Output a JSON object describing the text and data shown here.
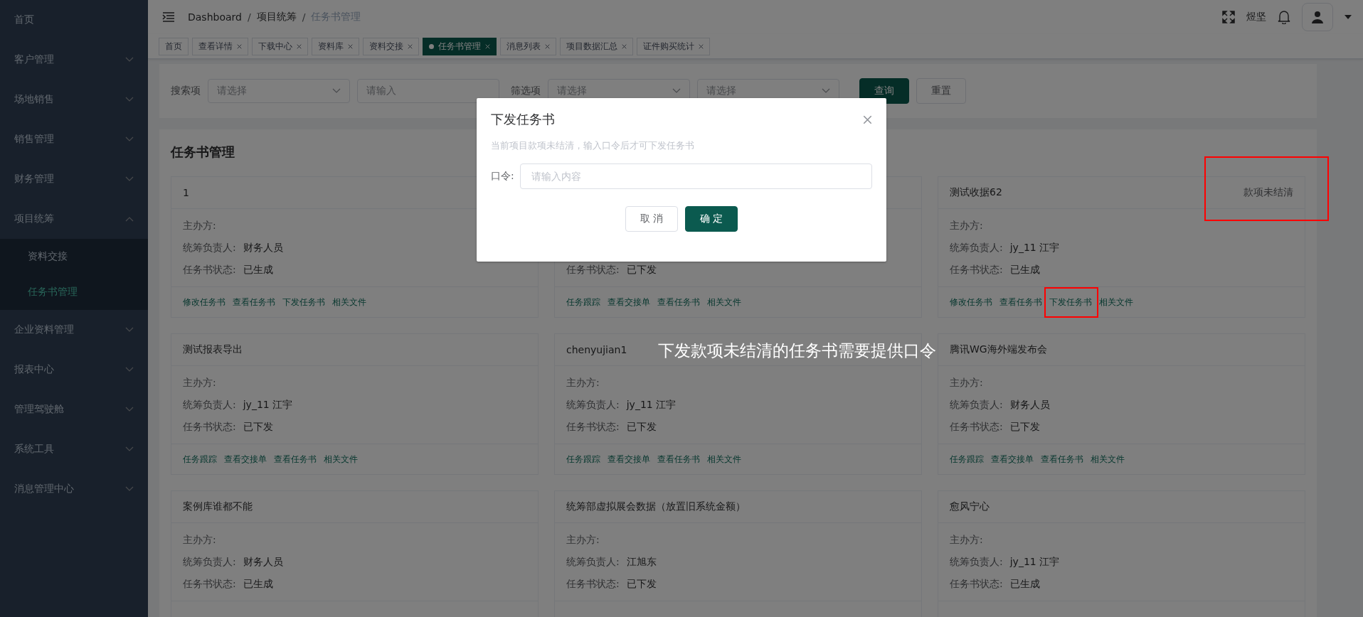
{
  "sidebar": {
    "items": [
      {
        "kind": "link",
        "label": "首页"
      },
      {
        "kind": "menu",
        "label": "客户管理",
        "expanded": false
      },
      {
        "kind": "menu",
        "label": "场地销售",
        "expanded": false
      },
      {
        "kind": "menu",
        "label": "销售管理",
        "expanded": false
      },
      {
        "kind": "menu",
        "label": "财务管理",
        "expanded": false
      },
      {
        "kind": "menu",
        "label": "项目统筹",
        "expanded": true,
        "children": [
          {
            "label": "资料交接",
            "selected": false
          },
          {
            "label": "任务书管理",
            "selected": true
          }
        ]
      },
      {
        "kind": "menu",
        "label": "企业资料管理",
        "expanded": false
      },
      {
        "kind": "menu",
        "label": "报表中心",
        "expanded": false
      },
      {
        "kind": "menu",
        "label": "管理驾驶舱",
        "expanded": false
      },
      {
        "kind": "menu",
        "label": "系统工具",
        "expanded": false
      },
      {
        "kind": "menu",
        "label": "消息管理中心",
        "expanded": false
      }
    ]
  },
  "navbar": {
    "breadcrumb": {
      "separator": "/",
      "items": [
        {
          "label": "Dashboard",
          "current": false
        },
        {
          "label": "项目统筹",
          "current": false
        },
        {
          "label": "任务书管理",
          "current": true
        }
      ]
    },
    "username": "煜坚"
  },
  "tabs": [
    {
      "label": "首页",
      "selected": false,
      "closable": false
    },
    {
      "label": "查看详情",
      "selected": false,
      "closable": true
    },
    {
      "label": "下载中心",
      "selected": false,
      "closable": true
    },
    {
      "label": "资料库",
      "selected": false,
      "closable": true
    },
    {
      "label": "资料交接",
      "selected": false,
      "closable": true
    },
    {
      "label": "任务书管理",
      "selected": true,
      "closable": true
    },
    {
      "label": "消息列表",
      "selected": false,
      "closable": true
    },
    {
      "label": "项目数据汇总",
      "selected": false,
      "closable": true
    },
    {
      "label": "证件购买统计",
      "selected": false,
      "closable": true
    }
  ],
  "search": {
    "fields": [
      {
        "kind": "label",
        "text": "搜索项"
      },
      {
        "kind": "select",
        "placeholder": "请选择"
      },
      {
        "kind": "input",
        "placeholder": "请输入"
      },
      {
        "kind": "label",
        "text": "筛选项"
      },
      {
        "kind": "select",
        "placeholder": "请选择"
      },
      {
        "kind": "select",
        "placeholder": "请选择"
      }
    ],
    "buttons": [
      {
        "label": "查询",
        "kind": "primary"
      },
      {
        "label": "重置",
        "kind": "default"
      }
    ]
  },
  "panel": {
    "title": "任务书管理",
    "rows": [
      {
        "cards": [
          {
            "title": "1",
            "fields": [
              {
                "kind": "organizer",
                "label": "主办方:"
              },
              {
                "kind": "manager",
                "label": "统筹负责人:",
                "value": "财务人员"
              },
              {
                "kind": "status",
                "label": "任务书状态:",
                "value": "已生成"
              }
            ],
            "links": [
              "修改任务书",
              "查看任务书",
              "下发任务书",
              "相关文件"
            ]
          },
          {
            "fields": [
              {
                "kind": "status",
                "label": "任务书状态:",
                "value": "已下发"
              }
            ],
            "links": [
              "任务跟踪",
              "查看交接单",
              "查看任务书",
              "相关文件"
            ]
          },
          {
            "title": "测试收据62",
            "badge": "款项未结清",
            "fields": [
              {
                "kind": "organizer",
                "label": "主办方:"
              },
              {
                "kind": "manager",
                "label": "统筹负责人:",
                "value": "jy_11 江宇"
              },
              {
                "kind": "status",
                "label": "任务书状态:",
                "value": "已生成"
              }
            ],
            "links": [
              "修改任务书",
              "查看任务书",
              "下发任务书",
              "相关文件"
            ]
          }
        ]
      },
      {
        "cards": [
          {
            "title": "测试报表导出",
            "fields": [
              {
                "kind": "organizer",
                "label": "主办方:"
              },
              {
                "kind": "manager",
                "label": "统筹负责人:",
                "value": "jy_11 江宇"
              },
              {
                "kind": "status",
                "label": "任务书状态:",
                "value": "已下发"
              }
            ],
            "links": [
              "任务跟踪",
              "查看交接单",
              "查看任务书",
              "相关文件"
            ]
          },
          {
            "title": "chenyujian1",
            "fields": [
              {
                "kind": "organizer",
                "label": "主办方:"
              },
              {
                "kind": "manager",
                "label": "统筹负责人:",
                "value": "jy_11 江宇"
              },
              {
                "kind": "status",
                "label": "任务书状态:",
                "value": "已下发"
              }
            ],
            "links": [
              "任务跟踪",
              "查看交接单",
              "查看任务书",
              "相关文件"
            ]
          },
          {
            "title": "腾讯WG海外端发布会",
            "fields": [
              {
                "kind": "organizer",
                "label": "主办方:"
              },
              {
                "kind": "manager",
                "label": "统筹负责人:",
                "value": "财务人员"
              },
              {
                "kind": "status",
                "label": "任务书状态:",
                "value": "已下发"
              }
            ],
            "links": [
              "任务跟踪",
              "查看交接单",
              "查看任务书",
              "相关文件"
            ]
          }
        ]
      },
      {
        "cards": [
          {
            "title": "案例库谁都不能",
            "fields": [
              {
                "kind": "organizer",
                "label": "主办方:"
              },
              {
                "kind": "manager",
                "label": "统筹负责人:",
                "value": "财务人员"
              },
              {
                "kind": "status",
                "label": "任务书状态:",
                "value": "已生成"
              }
            ]
          },
          {
            "title": "统筹部虚拟展会数据（放置旧系统金额）",
            "fields": [
              {
                "kind": "organizer",
                "label": "主办方:"
              },
              {
                "kind": "manager",
                "label": "统筹负责人:",
                "value": "江旭东"
              },
              {
                "kind": "status",
                "label": "任务书状态:",
                "value": "已下发"
              }
            ]
          },
          {
            "title": "愈风宁心",
            "fields": [
              {
                "kind": "organizer",
                "label": "主办方:"
              },
              {
                "kind": "manager",
                "label": "统筹负责人:",
                "value": "jy_11 江宇"
              },
              {
                "kind": "status",
                "label": "任务书状态:",
                "value": "已生成"
              }
            ]
          }
        ]
      }
    ]
  },
  "dialog": {
    "title": "下发任务书",
    "hint": "当前项目款项未结清，输入口令后才可下发任务书",
    "field_label": "口令:",
    "placeholder": "请输入内容",
    "buttons": [
      {
        "label": "取 消",
        "kind": "default"
      },
      {
        "label": "确 定",
        "kind": "primary"
      }
    ]
  },
  "annotation": {
    "note": "下发款项未结清的任务书需要提供口令"
  }
}
